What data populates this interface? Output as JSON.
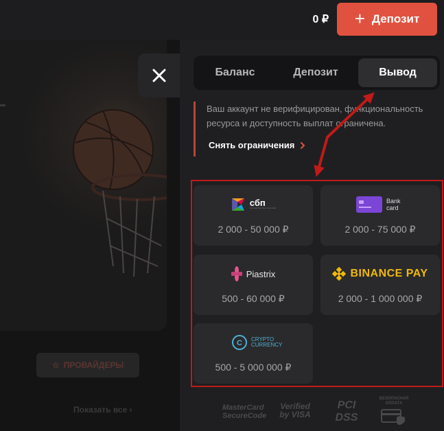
{
  "header": {
    "balance": "0 ₽",
    "deposit_button": "Депозит"
  },
  "background": {
    "providers_button": "ПРОВАЙДЕРЫ",
    "show_all": "Показать все"
  },
  "panel": {
    "tabs": [
      {
        "label": "Баланс",
        "active": false
      },
      {
        "label": "Депозит",
        "active": false
      },
      {
        "label": "Вывод",
        "active": true
      }
    ],
    "notice": {
      "text": "Ваш аккаунт не верифицирован, функциональность ресурса и доступность выплат ограничена.",
      "link": "Снять ограничения"
    },
    "methods": [
      {
        "name": "сбп",
        "caption": "система быстрых платежей",
        "range": "2 000 - 50 000 ₽"
      },
      {
        "name": "Bank card",
        "range": "2 000 - 75 000 ₽"
      },
      {
        "name": "Piastrix",
        "range": "500 - 60 000 ₽"
      },
      {
        "name": "BINANCE PAY",
        "range": "2 000 - 1 000 000 ₽"
      },
      {
        "name": "CRYPTO CURRENCY",
        "range": "500 - 5 000 000 ₽"
      }
    ],
    "footer": [
      "MasterCard SecureCode",
      "Verified by VISA",
      "PCI DSS",
      "БЕЗОПАСНАЯ ОПЛАТА"
    ]
  },
  "colors": {
    "accent": "#e0523f",
    "annotation": "#c01a1a",
    "panel_bg": "#1f1f21",
    "card_bg": "#2a2a2c"
  }
}
